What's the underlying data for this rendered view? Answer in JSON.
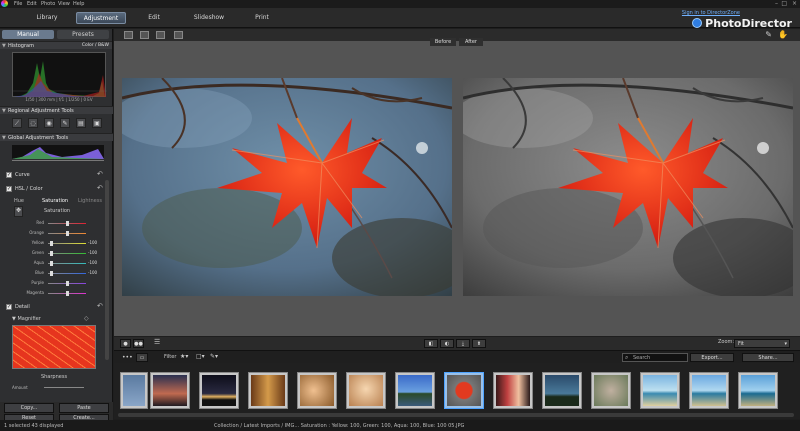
{
  "menubar": {
    "items": [
      "File",
      "Edit",
      "Photo",
      "View",
      "Help"
    ]
  },
  "modes": {
    "tabs": [
      "Library",
      "Adjustment",
      "Edit",
      "Slideshow",
      "Print"
    ],
    "active": "Adjustment"
  },
  "header": {
    "signin": "Sign in to DirectorZone",
    "brand": "PhotoDirector"
  },
  "left_panel": {
    "tabs": [
      "Manual",
      "Presets"
    ],
    "histogram": {
      "title": "Histogram",
      "mode": "Color / B&W",
      "info": "1/50 | 300 mm | f/1 | 1/250 | 0 EV"
    },
    "regional": {
      "title": "Regional Adjustment Tools"
    },
    "global": {
      "title": "Global Adjustment Tools"
    },
    "curve": {
      "label": "Curve",
      "checked": true
    },
    "hsl": {
      "label": "HSL / Color",
      "subtabs": [
        "Hue",
        "Saturation",
        "Lightness"
      ],
      "heading": "Saturation",
      "rows": [
        {
          "name": "Red",
          "value": ""
        },
        {
          "name": "Orange",
          "value": ""
        },
        {
          "name": "Yellow",
          "value": "-100"
        },
        {
          "name": "Green",
          "value": "-100"
        },
        {
          "name": "Aqua",
          "value": "-100"
        },
        {
          "name": "Blue",
          "value": "-100"
        },
        {
          "name": "Purple",
          "value": ""
        },
        {
          "name": "Magenta",
          "value": ""
        }
      ]
    },
    "detail": {
      "label": "Detail",
      "magnifier": "Magnifier",
      "sharpness": "Sharpness",
      "amount": "Amount"
    },
    "buttons": {
      "copy": "Copy...",
      "paste": "Paste",
      "reset": "Reset",
      "create": "Create..."
    }
  },
  "compare": {
    "before": "Before",
    "after": "After"
  },
  "zoom": {
    "label": "Zoom:",
    "value": "Fit"
  },
  "filterbar": {
    "filter": "Filter",
    "search_placeholder": "Search",
    "export": "Export...",
    "share": "Share..."
  },
  "status": "1 selected   43 displayed",
  "status_path": "Collection / Latest Imports / IMG...   Saturation : Yellow: 100, Green: 100, Aqua: 100, Blue: 100 05.JPG",
  "colors": {
    "accent": "#6a7a8e",
    "leaf": "#e8321a"
  },
  "thumbnails": [
    "bird",
    "sunset",
    "night-city",
    "interior",
    "family",
    "kids",
    "coast",
    "red-leaf",
    "people",
    "lake",
    "cat",
    "beach",
    "beach2",
    "beach3"
  ]
}
